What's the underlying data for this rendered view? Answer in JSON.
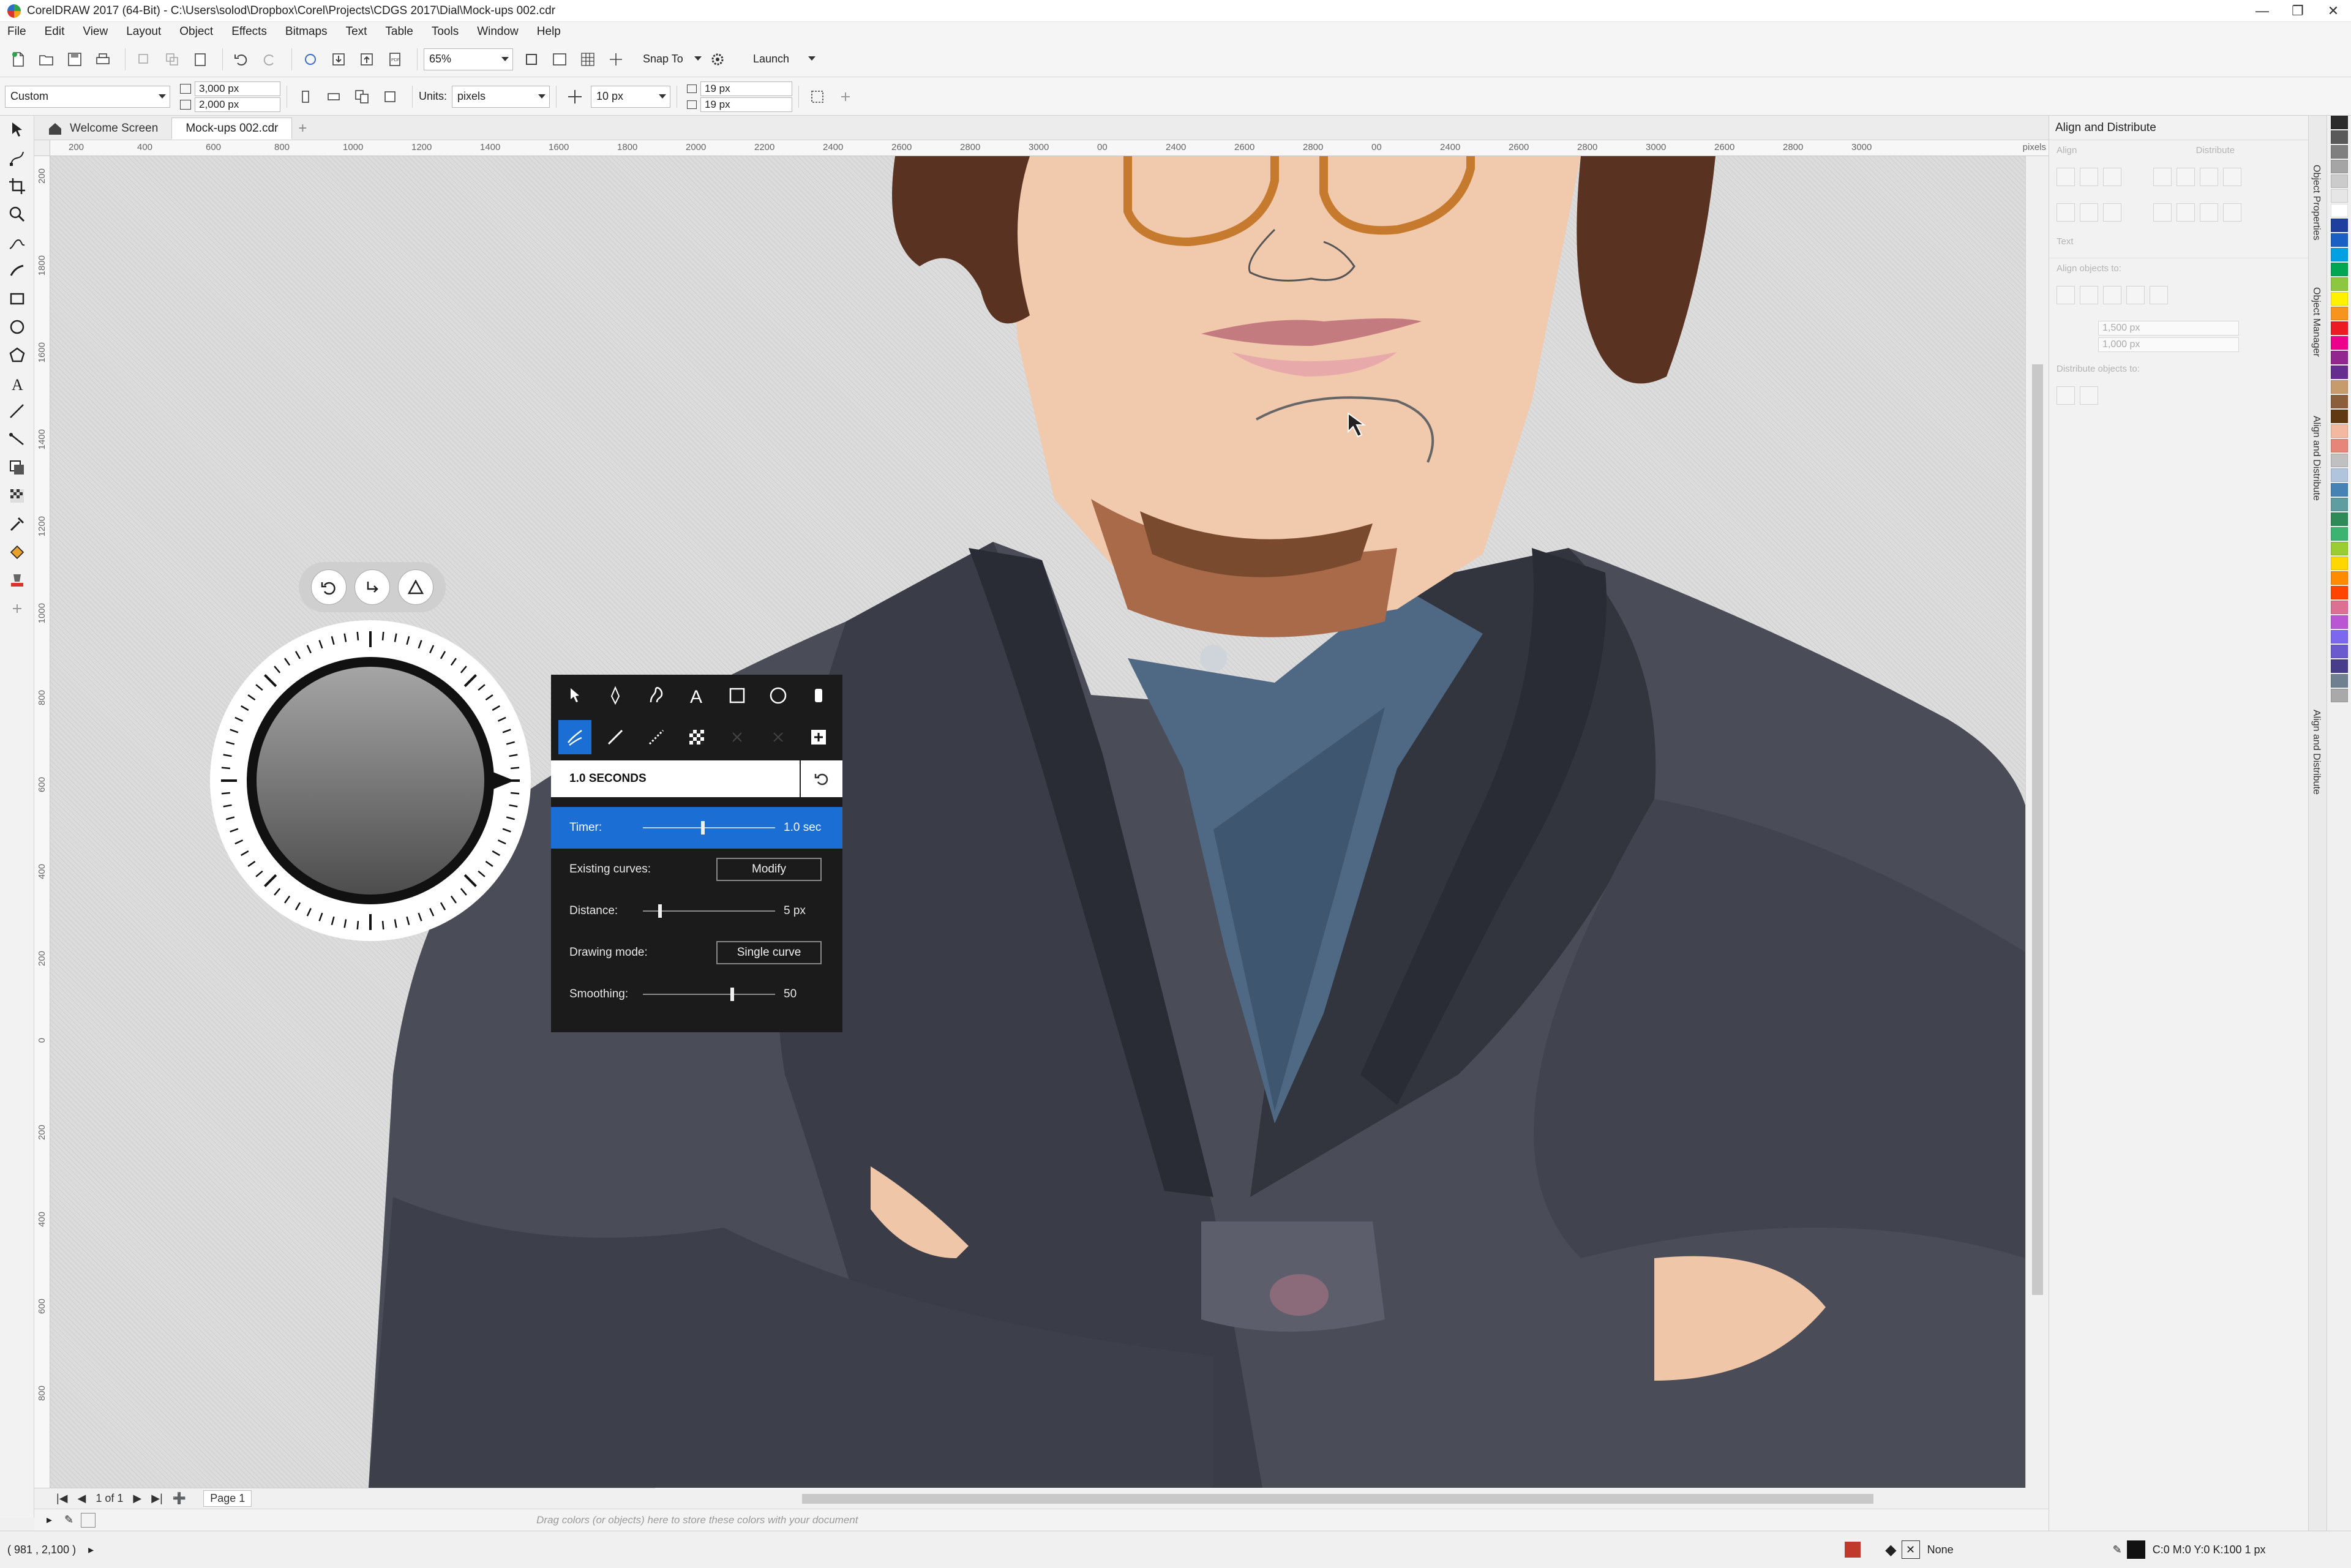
{
  "window": {
    "title": "CorelDRAW 2017 (64-Bit) - C:\\Users\\solod\\Dropbox\\Corel\\Projects\\CDGS 2017\\Dial\\Mock-ups 002.cdr"
  },
  "menu": [
    "File",
    "Edit",
    "View",
    "Layout",
    "Object",
    "Effects",
    "Bitmaps",
    "Text",
    "Table",
    "Tools",
    "Window",
    "Help"
  ],
  "toolbar": {
    "zoom": "65%",
    "snap_to": "Snap To",
    "launch": "Launch"
  },
  "propbar": {
    "preset": "Custom",
    "width": "3,000 px",
    "height": "2,000 px",
    "units_label": "Units:",
    "units": "pixels",
    "nudge": "10 px",
    "dup_x": "19 px",
    "dup_y": "19 px"
  },
  "tabs": [
    "Welcome Screen",
    "Mock-ups 002.cdr"
  ],
  "rulers": {
    "h_ticks": [
      "200",
      "400",
      "600",
      "800",
      "1000",
      "1200",
      "1400",
      "1600",
      "1800",
      "2000",
      "2200",
      "2400",
      "2600",
      "2800",
      "3000",
      "00",
      "2400",
      "2600",
      "2800",
      "00",
      "2400",
      "2600",
      "2800",
      "3000",
      "2600",
      "2800",
      "3000"
    ],
    "h_unit": "pixels",
    "v_ticks": [
      "200",
      "1800",
      "1600",
      "1400",
      "1200",
      "1000",
      "800",
      "600",
      "400",
      "200",
      "0",
      "200",
      "400",
      "600",
      "800"
    ]
  },
  "dial": {
    "quick_tools": [
      "undo-icon",
      "redo-icon",
      "triangle-icon"
    ],
    "panel": {
      "header": "1.0 SECONDS",
      "rows": [
        {
          "label": "Timer:",
          "value": "1.0 sec",
          "slider": 0.45,
          "active": true
        },
        {
          "label": "Existing curves:",
          "button": "Modify"
        },
        {
          "label": "Distance:",
          "value": "5 px",
          "slider": 0.12
        },
        {
          "label": "Drawing mode:",
          "button": "Single curve"
        },
        {
          "label": "Smoothing:",
          "value": "50",
          "slider": 0.68
        }
      ]
    }
  },
  "pagenav": {
    "page_counter": "1 of 1",
    "page_tab": "Page 1"
  },
  "color_docker_hint": "Drag colors (or objects) here to store these colors with your document",
  "status": {
    "coords": "( 981 , 2,100 )",
    "fill": "None",
    "outline": "C:0 M:0 Y:0 K:100  1 px"
  },
  "docker": {
    "title": "Align and Distribute",
    "align": "Align",
    "distribute": "Distribute",
    "text": "Text",
    "align_objects_to": "Align objects to:",
    "x_value": "1,500 px",
    "y_value": "1,000 px",
    "distribute_objects_to": "Distribute objects to:",
    "vtabs": [
      "Object Properties",
      "Object Manager",
      "Align and Distribute",
      "Align and Distribute"
    ]
  },
  "palette": [
    "#2b2b2b",
    "#595959",
    "#7f7f7f",
    "#a5a5a5",
    "#cbcbcb",
    "#e6e6e6",
    "#ffffff",
    "#1f3f9e",
    "#1a5fc4",
    "#00a0e3",
    "#00a651",
    "#8dc63f",
    "#fff200",
    "#f7941d",
    "#ed1c24",
    "#ec008c",
    "#92278f",
    "#662d91",
    "#c69c6d",
    "#8b5e3c",
    "#603913",
    "#f2b8a0",
    "#e8857a",
    "#c0c0c0",
    "#b0c4de",
    "#4682b4",
    "#5f9ea0",
    "#2e8b57",
    "#3cb371",
    "#9acd32",
    "#ffd700",
    "#ff8c00",
    "#ff4500",
    "#db7093",
    "#ba55d3",
    "#7b68ee",
    "#6a5acd",
    "#483d8b",
    "#708090",
    "#a9a9a9"
  ]
}
